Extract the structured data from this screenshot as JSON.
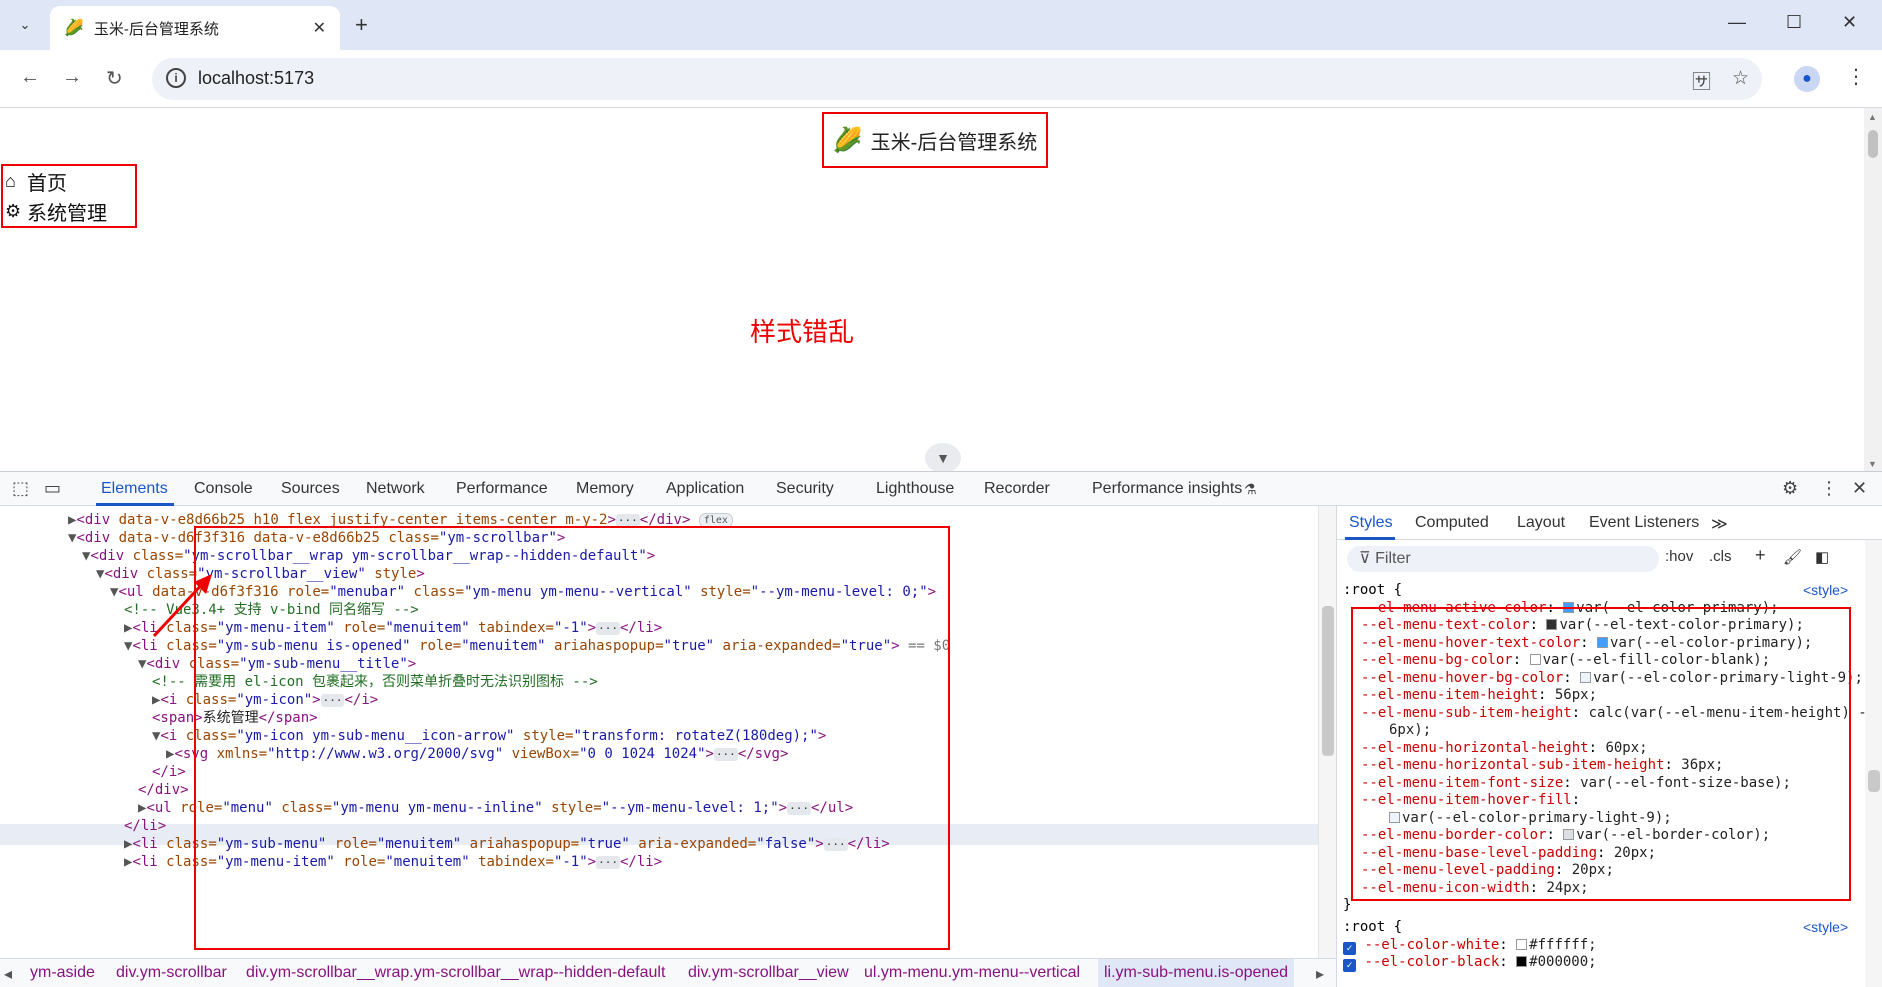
{
  "browser": {
    "tab_title": "玉米-后台管理系统",
    "tab_favicon": "🌽",
    "url": "localhost:5173"
  },
  "page": {
    "logo_icon": "🌽",
    "logo_title": "玉米-后台管理系统",
    "menu_items": [
      {
        "icon": "home-icon",
        "label": "首页"
      },
      {
        "icon": "gear-icon",
        "label": "系统管理"
      }
    ],
    "annotation": "样式错乱"
  },
  "devtools": {
    "tabs": [
      "Elements",
      "Console",
      "Sources",
      "Network",
      "Performance",
      "Memory",
      "Application",
      "Security",
      "Lighthouse",
      "Recorder",
      "Performance insights"
    ],
    "active_tab": "Elements",
    "breadcrumbs": [
      "ym-aside",
      "div.ym-scrollbar",
      "div.ym-scrollbar__wrap.ym-scrollbar__wrap--hidden-default",
      "div.ym-scrollbar__view",
      "ul.ym-menu.ym-menu--vertical",
      "li.ym-sub-menu.is-opened"
    ],
    "styles_tabs": [
      "Styles",
      "Computed",
      "Layout",
      "Event Listeners"
    ],
    "filter_placeholder": "Filter",
    "hov": ":hov",
    "cls": ".cls",
    "root_selector": ":root {",
    "style_source": "<style>",
    "root_selector2": ":root {",
    "style_source2": "<style>",
    "close_brace": "}",
    "root_vars": [
      {
        "name": "--el-menu-active-color",
        "value": "var(--el-color-primary);",
        "swatch": "#409eff"
      },
      {
        "name": "--el-menu-text-color",
        "value": "var(--el-text-color-primary);",
        "swatch": "#303133"
      },
      {
        "name": "--el-menu-hover-text-color",
        "value": "var(--el-color-primary);",
        "swatch": "#409eff"
      },
      {
        "name": "--el-menu-bg-color",
        "value": "var(--el-fill-color-blank);",
        "swatch": "#ffffff"
      },
      {
        "name": "--el-menu-hover-bg-color",
        "value": "var(--el-color-primary-light-9);",
        "swatch": "#ecf5ff"
      },
      {
        "name": "--el-menu-item-height",
        "value": "56px;"
      },
      {
        "name": "--el-menu-sub-item-height",
        "value": "calc(var(--el-menu-item-height) -"
      },
      {
        "name": "",
        "value": "6px);"
      },
      {
        "name": "--el-menu-horizontal-height",
        "value": "60px;"
      },
      {
        "name": "--el-menu-horizontal-sub-item-height",
        "value": "36px;"
      },
      {
        "name": "--el-menu-item-font-size",
        "value": "var(--el-font-size-base);"
      },
      {
        "name": "--el-menu-item-hover-fill",
        "value": ""
      },
      {
        "name": "",
        "value": "var(--el-color-primary-light-9);",
        "swatch": "#ecf5ff"
      },
      {
        "name": "--el-menu-border-color",
        "value": "var(--el-border-color);",
        "swatch": "#dcdfe6"
      },
      {
        "name": "--el-menu-base-level-padding",
        "value": "20px;"
      },
      {
        "name": "--el-menu-level-padding",
        "value": "20px;"
      },
      {
        "name": "--el-menu-icon-width",
        "value": "24px;"
      }
    ],
    "root2_vars": [
      {
        "name": "--el-color-white",
        "value": "#ffffff;",
        "swatch": "#ffffff"
      },
      {
        "name": "--el-color-black",
        "value": "#000000;",
        "swatch": "#000000"
      }
    ],
    "dom_lines": [
      {
        "indent": 0,
        "html": "<span class='tri'>▶</span><span class='tag'>&lt;div</span> <span class='attr'>data-v-e8d66b25</span> <span class='attr'>h10 flex justify-center items-center m-y-2</span><span class='tag'>&gt;</span><span class='ell'>···</span><span class='tag'>&lt;/div&gt;</span> <span class='pill'>flex</span>"
      },
      {
        "indent": 0,
        "html": "<span class='tri'>▼</span><span class='tag'>&lt;div</span> <span class='attr'>data-v-d6f3f316 data-v-e8d66b25 class=</span><span class='val'>\"ym-scrollbar\"</span><span class='tag'>&gt;</span>"
      },
      {
        "indent": 1,
        "html": "<span class='tri'>▼</span><span class='tag'>&lt;div</span> <span class='attr'>class=</span><span class='val'>\"ym-scrollbar__wrap ym-scrollbar__wrap--hidden-default\"</span><span class='tag'>&gt;</span>"
      },
      {
        "indent": 2,
        "html": "<span class='tri'>▼</span><span class='tag'>&lt;div</span> <span class='attr'>class=</span><span class='val'>\"ym-scrollbar__view\"</span> <span class='attr'>style</span><span class='tag'>&gt;</span>"
      },
      {
        "indent": 3,
        "html": "<span class='tri'>▼</span><span class='tag'>&lt;ul</span> <span class='attr'>data-v-d6f3f316 role=</span><span class='val'>\"menubar\"</span> <span class='attr'>class=</span><span class='val'>\"ym-menu ym-menu--vertical\"</span> <span class='attr'>style=</span><span class='val'>\"--ym-menu-level: 0;\"</span><span class='tag'>&gt;</span>"
      },
      {
        "indent": 4,
        "html": "<span class='cmt'>&lt;!-- Vue3.4+ 支持 v-bind 同名缩写 --&gt;</span>"
      },
      {
        "indent": 4,
        "html": "<span class='tri'>▶</span><span class='tag'>&lt;li</span> <span class='attr'>class=</span><span class='val'>\"ym-menu-item\"</span> <span class='attr'>role=</span><span class='val'>\"menuitem\"</span> <span class='attr'>tabindex=</span><span class='val'>\"-1\"</span><span class='tag'>&gt;</span><span class='ell'>···</span><span class='tag'>&lt;/li&gt;</span>"
      },
      {
        "indent": 4,
        "html": "<span class='tri'>▼</span><span class='tag'>&lt;li</span> <span class='attr'>class=</span><span class='val'>\"ym-sub-menu is-opened\"</span> <span class='attr'>role=</span><span class='val'>\"menuitem\"</span> <span class='attr'>ariahaspopup=</span><span class='val'>\"true\"</span> <span class='attr'>aria-expanded=</span><span class='val'>\"true\"</span><span class='tag'>&gt;</span> <span style='color:#777'>== $0</span>"
      },
      {
        "indent": 5,
        "html": "<span class='tri'>▼</span><span class='tag'>&lt;div</span> <span class='attr'>class=</span><span class='val'>\"ym-sub-menu__title\"</span><span class='tag'>&gt;</span>"
      },
      {
        "indent": 6,
        "html": "<span class='cmt'>&lt;!-- 需要用 el-icon 包裹起来，否则菜单折叠时无法识别图标 --&gt;</span>"
      },
      {
        "indent": 6,
        "html": "<span class='tri'>▶</span><span class='tag'>&lt;i</span> <span class='attr'>class=</span><span class='val'>\"ym-icon\"</span><span class='tag'>&gt;</span><span class='ell'>···</span><span class='tag'>&lt;/i&gt;</span>"
      },
      {
        "indent": 6,
        "html": "<span class='tag'>&lt;span&gt;</span><span class='txt'>系统管理</span><span class='tag'>&lt;/span&gt;</span>"
      },
      {
        "indent": 6,
        "html": "<span class='tri'>▼</span><span class='tag'>&lt;i</span> <span class='attr'>class=</span><span class='val'>\"ym-icon ym-sub-menu__icon-arrow\"</span> <span class='attr'>style=</span><span class='val'>\"transform: rotateZ(180deg);\"</span><span class='tag'>&gt;</span>"
      },
      {
        "indent": 7,
        "html": "<span class='tri'>▶</span><span class='tag'>&lt;svg</span> <span class='attr'>xmlns=</span><span class='val'>\"http://www.w3.org/2000/svg\"</span> <span class='attr'>viewBox=</span><span class='val'>\"0 0 1024 1024\"</span><span class='tag'>&gt;</span><span class='ell'>···</span><span class='tag'>&lt;/svg&gt;</span>"
      },
      {
        "indent": 6,
        "html": "<span class='tag'>&lt;/i&gt;</span>"
      },
      {
        "indent": 5,
        "html": "<span class='tag'>&lt;/div&gt;</span>"
      },
      {
        "indent": 5,
        "html": "<span class='tri'>▶</span><span class='tag'>&lt;ul</span> <span class='attr'>role=</span><span class='val'>\"menu\"</span> <span class='attr'>class=</span><span class='val'>\"ym-menu ym-menu--inline\"</span> <span class='attr'>style=</span><span class='val'>\"--ym-menu-level: 1;\"</span><span class='tag'>&gt;</span><span class='ell'>···</span><span class='tag'>&lt;/ul&gt;</span>"
      },
      {
        "indent": 4,
        "html": "<span class='tag'>&lt;/li&gt;</span>"
      },
      {
        "indent": 4,
        "html": "<span class='tri'>▶</span><span class='tag'>&lt;li</span> <span class='attr'>class=</span><span class='val'>\"ym-sub-menu\"</span> <span class='attr'>role=</span><span class='val'>\"menuitem\"</span> <span class='attr'>ariahaspopup=</span><span class='val'>\"true\"</span> <span class='attr'>aria-expanded=</span><span class='val'>\"false\"</span><span class='tag'>&gt;</span><span class='ell'>···</span><span class='tag'>&lt;/li&gt;</span>"
      },
      {
        "indent": 4,
        "html": "<span class='tri'>▶</span><span class='tag'>&lt;li</span> <span class='attr'>class=</span><span class='val'>\"ym-menu-item\"</span> <span class='attr'>role=</span><span class='val'>\"menuitem\"</span> <span class='attr'>tabindex=</span><span class='val'>\"-1\"</span><span class='tag'>&gt;</span><span class='ell'>···</span><span class='tag'>&lt;/li&gt;</span>"
      }
    ]
  }
}
